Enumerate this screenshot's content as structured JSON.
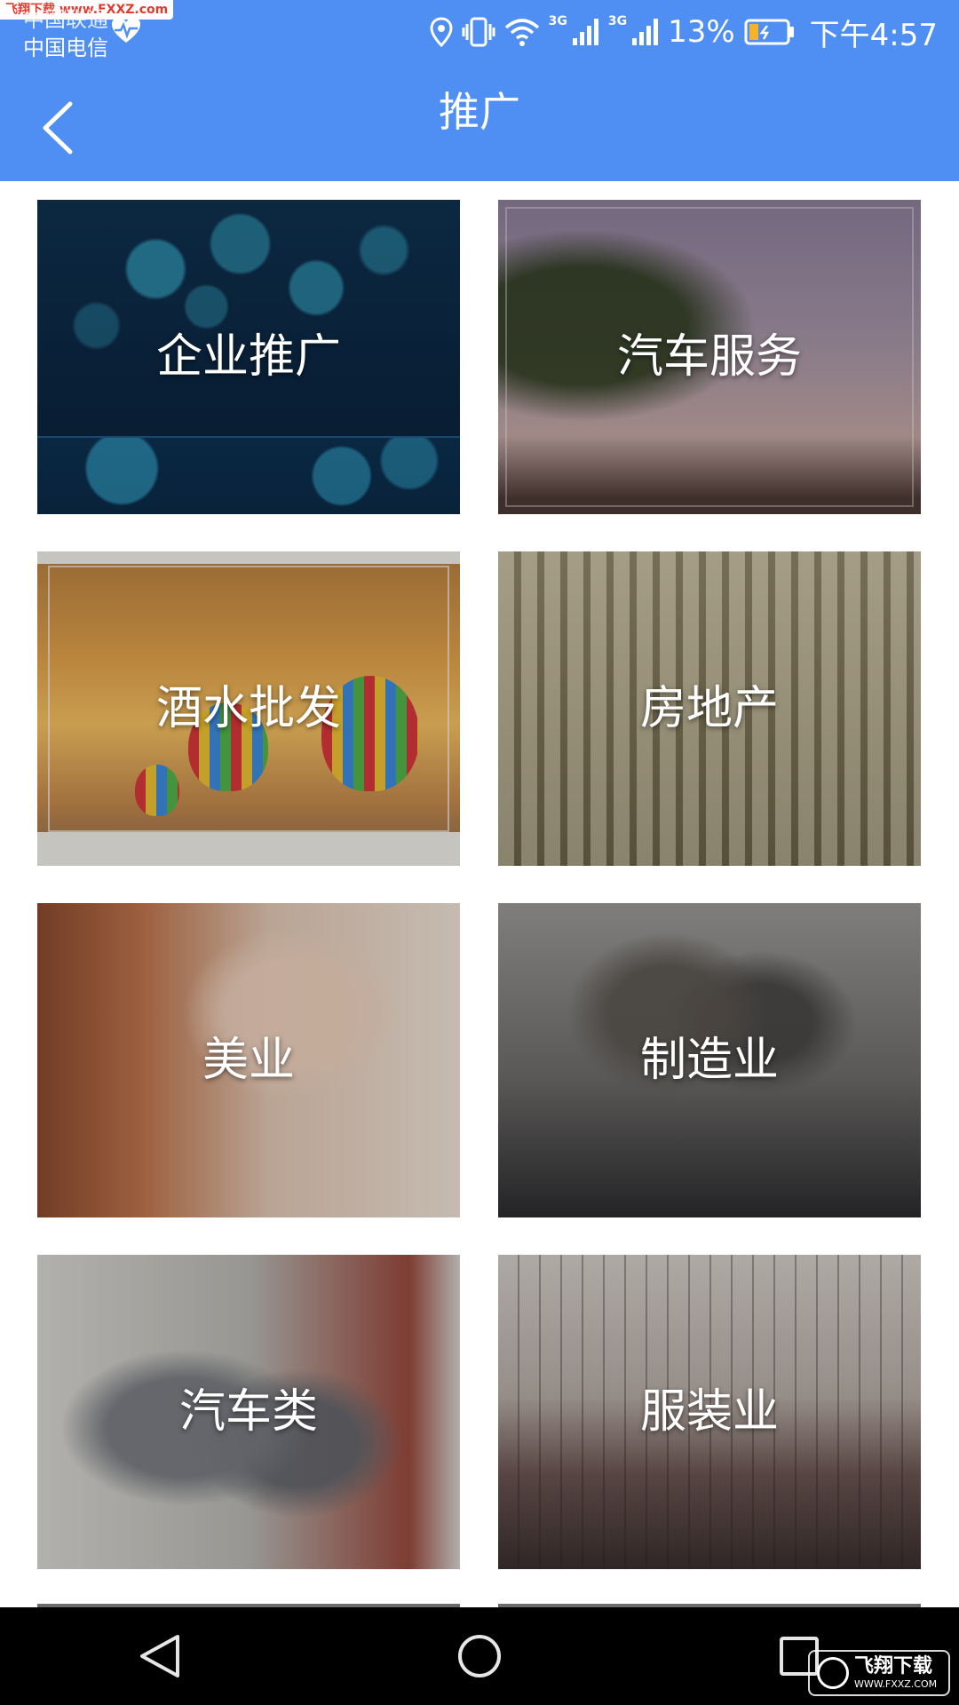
{
  "status_bar": {
    "watermark": "飞翔下载 www.FXXZ.com",
    "carrier_1": "中国联通",
    "carrier_2": "中国电信",
    "net_1": "3G",
    "net_2": "3G",
    "battery": "13%",
    "time": "下午4:57",
    "icons": [
      "heart-icon",
      "location-icon",
      "vibrate-icon",
      "wifi-icon",
      "signal-icon",
      "signal-icon",
      "battery-icon"
    ]
  },
  "header": {
    "title": "推广",
    "back_icon": "chevron-left-icon"
  },
  "categories": [
    {
      "label": "企业推广",
      "image": "enterprise-brochure"
    },
    {
      "label": "汽车服务",
      "image": "vine-sky"
    },
    {
      "label": "酒水批发",
      "image": "hot-air-balloons"
    },
    {
      "label": "房地产",
      "image": "city-model"
    },
    {
      "label": "美业",
      "image": "spa-massage"
    },
    {
      "label": "制造业",
      "image": "factory-workers"
    },
    {
      "label": "汽车类",
      "image": "mechanics"
    },
    {
      "label": "服装业",
      "image": "clothing-rack"
    }
  ],
  "nav_bar": {
    "back": "triangle-back-icon",
    "home": "circle-home-icon",
    "recents": "square-recents-icon"
  },
  "footer_watermark": {
    "main": "飞翔下载",
    "sub": "WWW.FXXZ.COM"
  },
  "colors": {
    "primary": "#4f8ff3",
    "nav_bg": "#000000",
    "text_on_image": "#ffffff"
  }
}
